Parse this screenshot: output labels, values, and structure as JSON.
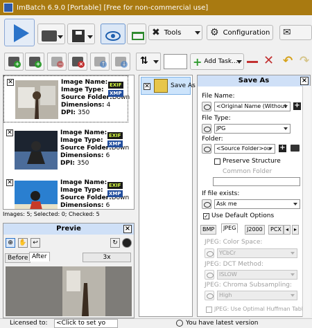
{
  "window": {
    "title": "ImBatch 6.9.0 [Portable] [Free for non-commercial use]"
  },
  "toolbar": {
    "tools_label": "Tools",
    "configuration_label": "Configuration",
    "add_task_label": "Add Task...",
    "sort_value": ""
  },
  "image_list": {
    "items": [
      {
        "name_label": "Image Name:",
        "type_label": "Image Type:",
        "source_label": "Source Folder:",
        "source_value": "Downlo",
        "dimensions_label": "Dimensions:",
        "dimensions_value": "4",
        "dpi_label": "DPI:",
        "dpi_value": "350",
        "tags": [
          "EXIF",
          "XMP"
        ]
      },
      {
        "name_label": "Image Name:",
        "type_label": "Image Type:",
        "source_label": "Source Folder:",
        "source_value": "Downlo",
        "dimensions_label": "Dimensions:",
        "dimensions_value": "6",
        "dpi_label": "DPI:",
        "dpi_value": "350",
        "tags": [
          "EXIF",
          "XMP"
        ]
      },
      {
        "name_label": "Image Name:",
        "type_label": "Image Type:",
        "source_label": "Source Folder:",
        "source_value": "Downlo",
        "dimensions_label": "Dimensions:",
        "dimensions_value": "6",
        "dpi_label": "",
        "dpi_value": "",
        "tags": [
          "EXIF",
          "XMP"
        ]
      }
    ],
    "status": "Images: 5; Selected: 0; Checked: 5"
  },
  "preview": {
    "title": "Previe",
    "tab_before": "Before",
    "tab_after": "After",
    "zoom_value": "3x"
  },
  "task_list": {
    "item_label": "Save As"
  },
  "save_as": {
    "title": "Save As",
    "file_name_label": "File Name:",
    "file_name_value": "<Original Name (Without",
    "file_type_label": "File Type:",
    "file_type_value": "JPG",
    "folder_label": "Folder:",
    "folder_value": "<Source Folder>ou",
    "preserve_structure_label": "Preserve Structure",
    "common_folder_label": "Common Folder",
    "common_folder_value": "",
    "if_exists_label": "If file exists:",
    "if_exists_value": "Ask me",
    "use_default_label": "Use Default Options",
    "format_tabs": [
      "BMP",
      "JPEG",
      "J2000",
      "PCX"
    ],
    "color_space_label": "JPEG: Color Space:",
    "color_space_value": "YCbCr",
    "dct_label": "JPEG: DCT Method:",
    "dct_value": "ISLOW",
    "chroma_label": "JPEG: Chroma Subsampling:",
    "chroma_value": "High",
    "huffman_label": "JPEG: Use Optimal Huffman Tabl"
  },
  "statusbar": {
    "licensed_label": "Licensed to:",
    "licensed_value": "<Click to set yo",
    "version_text": "You have latest version"
  },
  "colors": {
    "titlebar": "#a97a11",
    "accent_blue": "#2b73c9",
    "panel_header": "#cfe0f7",
    "exif_tag": "#d9ff3f"
  }
}
